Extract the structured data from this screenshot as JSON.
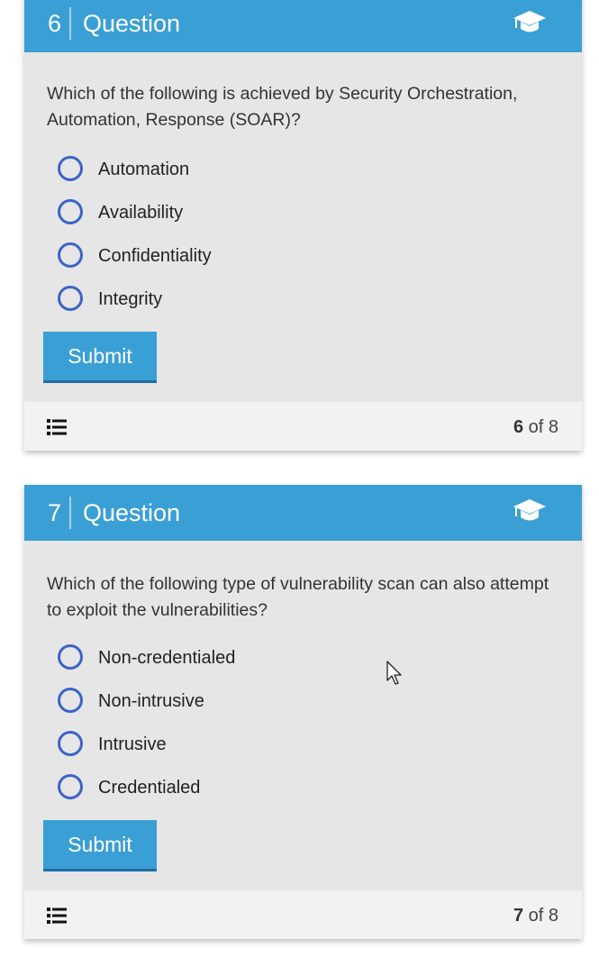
{
  "colors": {
    "header_bg": "#3a9fd4",
    "card_bg": "#e6e6e6",
    "footer_bg": "#f2f2f2",
    "radio_border": "#3d63c6",
    "submit_bg": "#3a9fd4"
  },
  "cards": [
    {
      "number": "6",
      "title": "Question",
      "header_icon": "graduation-cap-icon",
      "question": "Which of the following is achieved by Security Orchestration, Automation, Response (SOAR)?",
      "options": [
        "Automation",
        "Availability",
        "Confidentiality",
        "Integrity"
      ],
      "submit_label": "Submit",
      "footer_icon": "list-icon",
      "progress": {
        "current": "6",
        "separator": "of",
        "total": "8"
      }
    },
    {
      "number": "7",
      "title": "Question",
      "header_icon": "graduation-cap-icon",
      "question": "Which of the following type of vulnerability scan can also attempt to exploit the vulnerabilities?",
      "options": [
        "Non-credentialed",
        "Non-intrusive",
        "Intrusive",
        "Credentialed"
      ],
      "submit_label": "Submit",
      "footer_icon": "list-icon",
      "progress": {
        "current": "7",
        "separator": "of",
        "total": "8"
      }
    }
  ],
  "cursor_icon": "mouse-pointer-icon"
}
